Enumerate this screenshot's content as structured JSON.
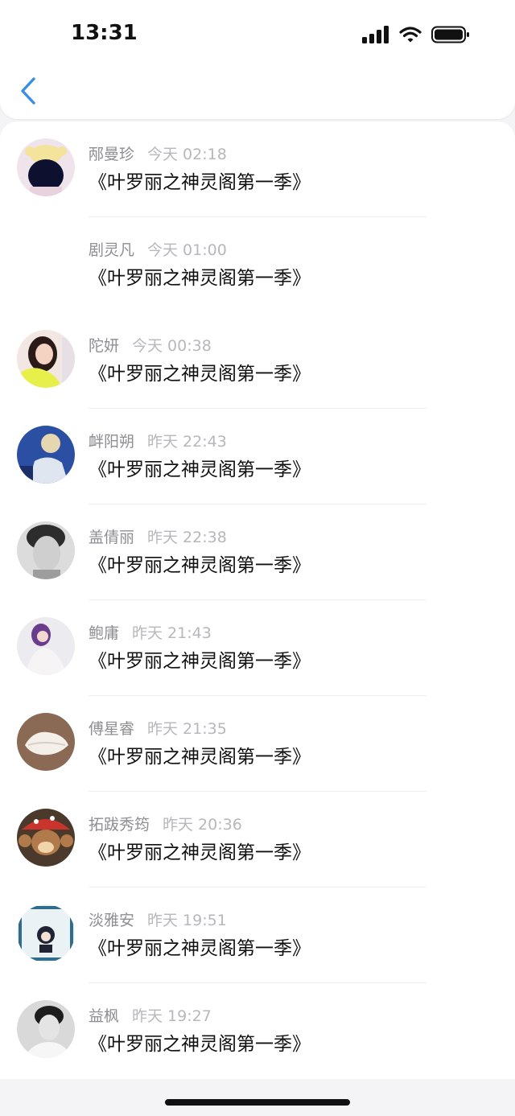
{
  "status_bar": {
    "time": "13:31"
  },
  "nav": {
    "back_icon": "chevron-left-icon",
    "accent": "#3a8ee6"
  },
  "comments": [
    {
      "name": "邴曼珍",
      "time": "今天 02:18",
      "text": "《叶罗丽之神灵阁第一季》",
      "avatar": true
    },
    {
      "name": "剧灵凡",
      "time": "今天 01:00",
      "text": "《叶罗丽之神灵阁第一季》",
      "avatar": false
    },
    {
      "name": "陀妍",
      "time": "今天 00:38",
      "text": "《叶罗丽之神灵阁第一季》",
      "avatar": true
    },
    {
      "name": "衅阳朔",
      "time": "昨天 22:43",
      "text": "《叶罗丽之神灵阁第一季》",
      "avatar": true
    },
    {
      "name": "盖倩丽",
      "time": "昨天 22:38",
      "text": "《叶罗丽之神灵阁第一季》",
      "avatar": true
    },
    {
      "name": "鲍庸",
      "time": "昨天 21:43",
      "text": "《叶罗丽之神灵阁第一季》",
      "avatar": true
    },
    {
      "name": "傅星睿",
      "time": "昨天 21:35",
      "text": "《叶罗丽之神灵阁第一季》",
      "avatar": true
    },
    {
      "name": "拓跋秀筠",
      "time": "昨天 20:36",
      "text": "《叶罗丽之神灵阁第一季》",
      "avatar": true
    },
    {
      "name": "淡雅安",
      "time": "昨天 19:51",
      "text": "《叶罗丽之神灵阁第一季》",
      "avatar": true
    },
    {
      "name": "益枫",
      "time": "昨天 19:27",
      "text": "《叶罗丽之神灵阁第一季》",
      "avatar": true
    }
  ]
}
